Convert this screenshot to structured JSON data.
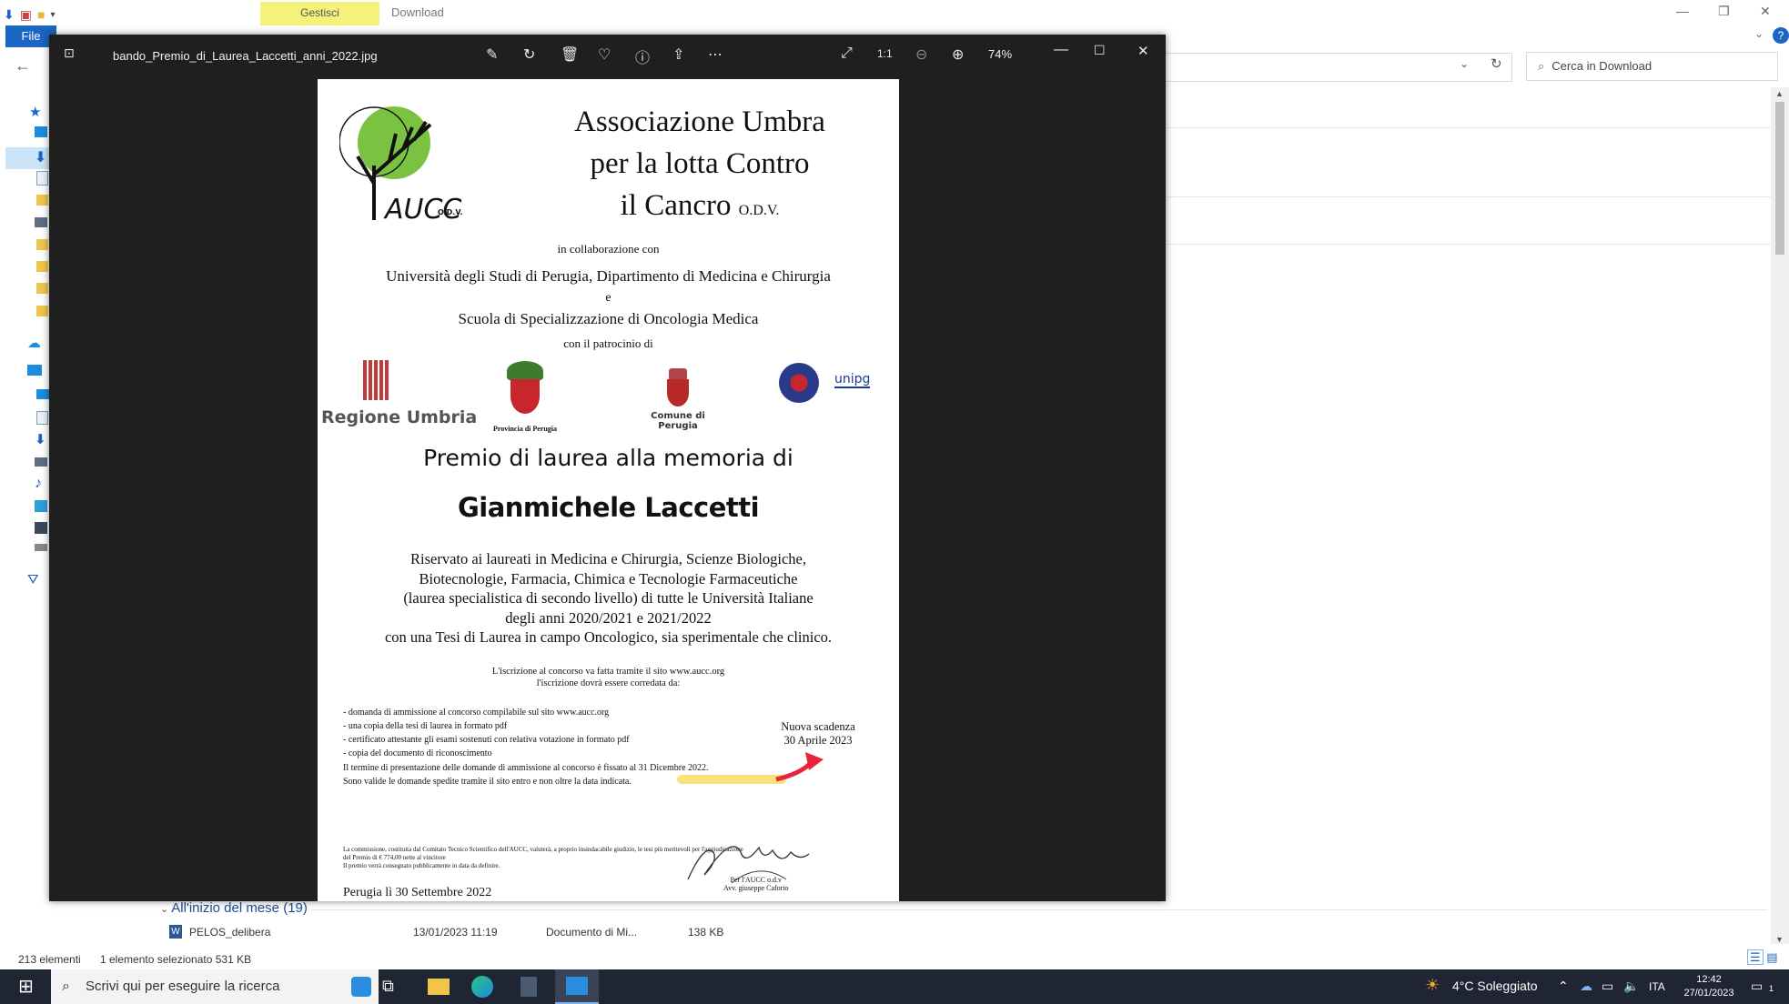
{
  "explorer": {
    "ribbon_context": "Gestisci",
    "ribbon_title": "Download",
    "file_tab": "File",
    "search_placeholder": "Cerca in Download",
    "group_header": "All'inizio del mese (19)",
    "row": {
      "name": "PELOS_delibera",
      "date": "13/01/2023 11:19",
      "type": "Documento di Mi...",
      "size": "138 KB"
    },
    "status_count": "213 elementi",
    "status_selection": "1 elemento selezionato  531 KB"
  },
  "viewer": {
    "filename": "bando_Premio_di_Laurea_Laccetti_anni_2022.jpg",
    "zoom": "74%"
  },
  "document": {
    "title_line1": "Associazione Umbra",
    "title_line2": "per la lotta Contro",
    "title_line3": "il Cancro",
    "title_suffix": "O.D.V.",
    "logo_text": "AUCC",
    "logo_odv": "O.D.V.",
    "collab": "in collaborazione con",
    "university": "Università degli Studi di Perugia, Dipartimento di Medicina e Chirurgia",
    "and": "e",
    "school": "Scuola di Specializzazione di Oncologia Medica",
    "patronage": "con il patrocinio di",
    "sponsor_regione": "Regione Umbria",
    "sponsor_provincia": "Provincia di Perugia",
    "sponsor_comune": "Comune di Perugia",
    "sponsor_unipg": "unipg",
    "prize_heading": "Premio di laurea alla memoria di",
    "honoree": "Gianmichele Laccetti",
    "desc1": "Riservato ai laureati in Medicina e Chirurgia, Scienze Biologiche,",
    "desc2": "Biotecnologie, Farmacia, Chimica e Tecnologie Farmaceutiche",
    "desc3": "(laurea specialistica di secondo livello) di tutte le Università Italiane",
    "desc4": "degli anni  2020/2021 e 2021/2022",
    "desc5": "con una Tesi di Laurea in campo Oncologico, sia sperimentale che clinico.",
    "signup1": "L'iscrizione al concorso va fatta tramite il sito www.aucc.org",
    "signup2": "l'iscrizione dovrà essere corredata da:",
    "req1": "- domanda di ammissione al concorso compilabile sul sito www.aucc.org",
    "req2": "- una copia  della tesi di laurea in formato pdf",
    "req3": "- certificato attestante gli esami sostenuti con relativa votazione in formato pdf",
    "req4": "- copia del documento di riconoscimento",
    "deadline1": "Il termine di presentazione delle domande di ammissione al concorso è fissato al 31 Dicembre 2022.",
    "deadline2": "Sono valide le domande spedite tramite il sito entro e non oltre la data indicata.",
    "new_deadline_label": "Nuova scadenza",
    "new_deadline_date": "30 Aprile 2023",
    "commission1": "La commissione, costituita dal Comitato Tecnico Scientifico dell'AUCC, valuterà, a proprio insindacabile giudizio, le tesi più meritevoli per l'aggiudicazione",
    "commission2": "del Premio di € 774,00 nette al vincitore",
    "commission3": " Il premio  verrà consegnato pubblicamente in data da definire.",
    "place_date": "Perugia lì 30 Settembre 2022",
    "signer1": "Per l'AUCC o.d.v",
    "signer2": "Avv. giuseppe Caforio"
  },
  "taskbar": {
    "search_placeholder": "Scrivi qui per eseguire la ricerca",
    "weather": "4°C  Soleggiato",
    "language": "ITA",
    "time": "12:42",
    "date": "27/01/2023",
    "notifications": "1"
  },
  "colors": {
    "accent": "#1a66c2",
    "viewer_bg": "#1f1f1f",
    "taskbar_bg": "#1f2532",
    "ribbon_ctx": "#f4f27a",
    "highlight": "#f6e06a",
    "arrow": "#e8243b"
  }
}
